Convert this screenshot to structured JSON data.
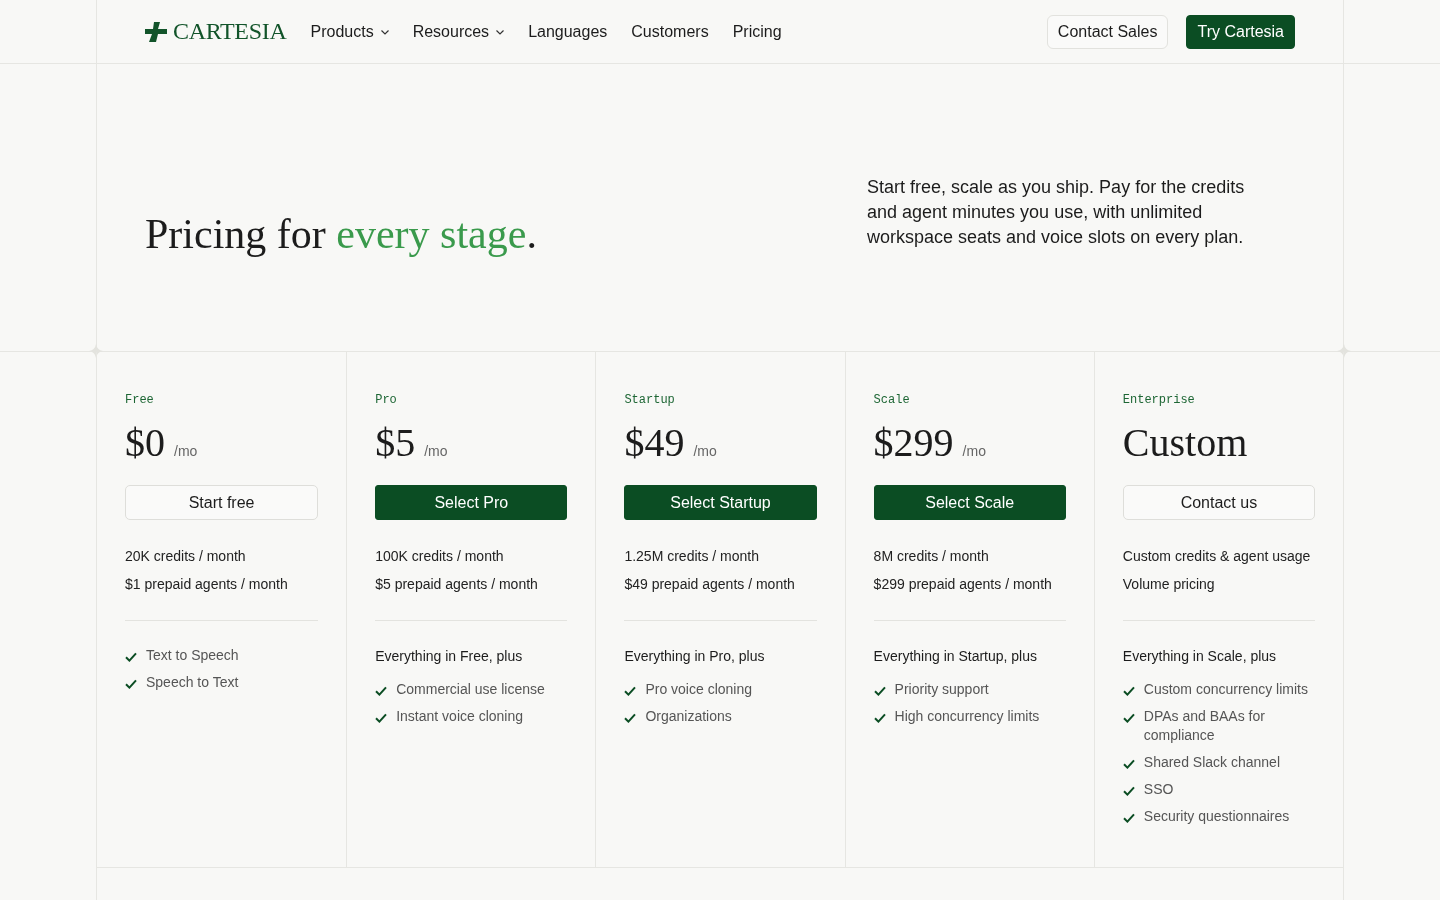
{
  "nav": {
    "logo": "CARTESIA",
    "links": [
      {
        "label": "Products",
        "dropdown": true
      },
      {
        "label": "Resources",
        "dropdown": true
      },
      {
        "label": "Languages",
        "dropdown": false
      },
      {
        "label": "Customers",
        "dropdown": false
      },
      {
        "label": "Pricing",
        "dropdown": false
      }
    ],
    "buttons": [
      {
        "label": "Contact Sales",
        "kind": "outline"
      },
      {
        "label": "Try Cartesia",
        "kind": "primary"
      }
    ]
  },
  "hero": {
    "title": [
      {
        "text": "Pricing for ",
        "accent": false
      },
      {
        "text": "every stage",
        "accent": true
      },
      {
        "text": ".",
        "accent": false
      }
    ],
    "description": "Start free, scale as you ship. Pay for the credits and agent minutes you use, with unlimited workspace seats and voice slots on every plan."
  },
  "plans": [
    {
      "tier": "Free",
      "price": "$0",
      "period": "/mo",
      "button": {
        "label": "Start free",
        "kind": "outline"
      },
      "allowances": [
        "20K credits / month",
        "$1 prepaid agents / month"
      ],
      "features": [
        "Text to Speech",
        "Speech to Text"
      ]
    },
    {
      "tier": "Pro",
      "price": "$5",
      "period": "/mo",
      "button": {
        "label": "Select Pro",
        "kind": "primary"
      },
      "allowances": [
        "100K credits / month",
        "$5 prepaid agents / month"
      ],
      "features_heading": "Everything in Free, plus",
      "features": [
        "Commercial use license",
        "Instant voice cloning"
      ]
    },
    {
      "tier": "Startup",
      "price": "$49",
      "period": "/mo",
      "button": {
        "label": "Select Startup",
        "kind": "primary"
      },
      "allowances": [
        "1.25M credits / month",
        "$49 prepaid agents / month"
      ],
      "features_heading": "Everything in Pro, plus",
      "features": [
        "Pro voice cloning",
        "Organizations"
      ]
    },
    {
      "tier": "Scale",
      "price": "$299",
      "period": "/mo",
      "button": {
        "label": "Select Scale",
        "kind": "primary"
      },
      "allowances": [
        "8M credits / month",
        "$299 prepaid agents / month"
      ],
      "features_heading": "Everything in Startup, plus",
      "features": [
        "Priority support",
        "High concurrency limits"
      ]
    },
    {
      "tier": "Enterprise",
      "price": "Custom",
      "button": {
        "label": "Contact us",
        "kind": "outline"
      },
      "allowances": [
        "Custom credits & agent usage",
        "Volume pricing"
      ],
      "features_heading": "Everything in Scale, plus",
      "features": [
        "Custom concurrency limits",
        "DPAs and BAAs for compliance",
        "Shared Slack channel",
        "SSO",
        "Security questionnaires"
      ]
    }
  ]
}
